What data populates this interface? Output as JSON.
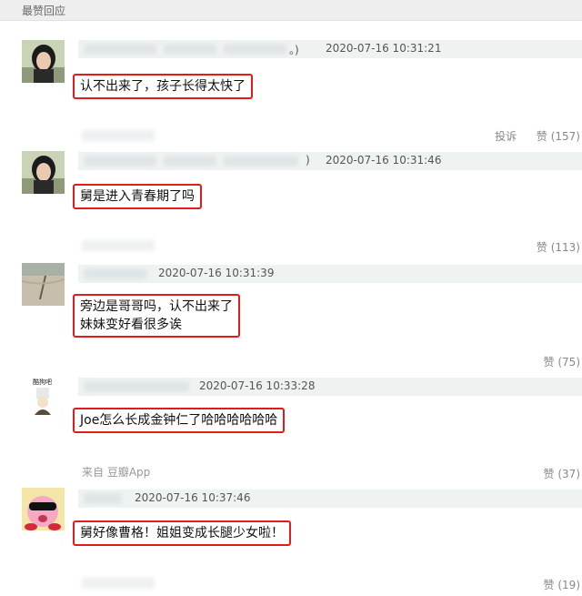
{
  "header": {
    "title": "最赞回应"
  },
  "comments": [
    {
      "timestamp": "2020-07-16 10:31:21",
      "name_suffix": "。)",
      "text_lines": [
        "认不出来了，孩子长得太快了"
      ],
      "actions": {
        "report": "投诉",
        "likes": "赞 (157)"
      }
    },
    {
      "timestamp": "2020-07-16 10:31:46",
      "name_suffix": ")",
      "text_lines": [
        "舅是进入青春期了吗"
      ],
      "actions": {
        "likes": "赞 (113)"
      }
    },
    {
      "timestamp": "2020-07-16 10:31:39",
      "text_lines": [
        "旁边是哥哥吗，认不出来了",
        "妹妹变好看很多诶"
      ],
      "actions": {
        "likes": "赞 (75)"
      }
    },
    {
      "timestamp": "2020-07-16 10:33:28",
      "avatar_label": "酷狗吧",
      "text_lines": [
        "Joe怎么长成金钟仁了哈哈哈哈哈哈"
      ],
      "source": "来自 豆瓣App",
      "actions": {
        "likes": "赞 (37)"
      }
    },
    {
      "timestamp": "2020-07-16 10:37:46",
      "text_lines": [
        "舅好像曹格！姐姐变成长腿少女啦！"
      ],
      "actions": {
        "likes": "赞 (19)"
      }
    }
  ]
}
